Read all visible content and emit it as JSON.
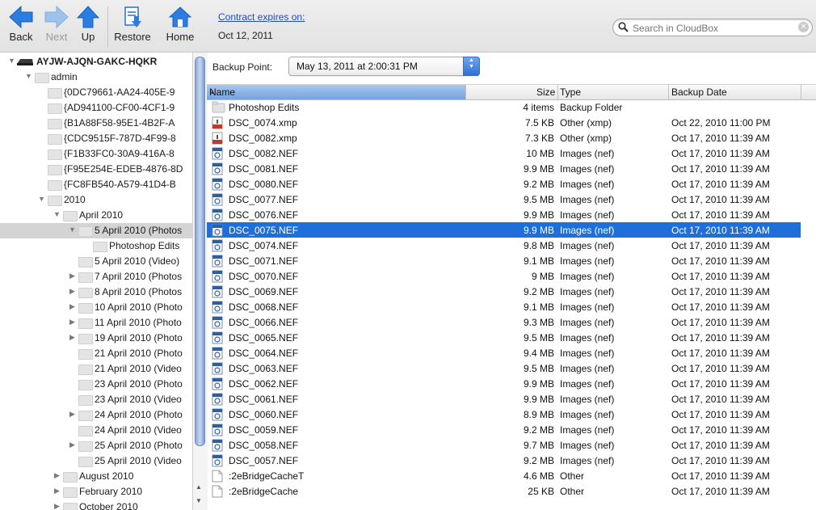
{
  "toolbar": {
    "back": "Back",
    "next": "Next",
    "up": "Up",
    "restore": "Restore",
    "home": "Home"
  },
  "contract": {
    "link": "Contract expires on:",
    "date": "Oct 12, 2011"
  },
  "search": {
    "placeholder": "Search in CloudBox"
  },
  "sidebar": {
    "drive": "AYJW-AJQN-GAKC-HQKR",
    "items": [
      {
        "label": "admin"
      },
      {
        "label": "{0DC79661-AA24-405E-9"
      },
      {
        "label": "{AD941100-CF00-4CF1-9"
      },
      {
        "label": "{B1A88F58-95E1-4B2F-A"
      },
      {
        "label": "{CDC9515F-787D-4F99-8"
      },
      {
        "label": "{F1B33FC0-30A9-416A-8"
      },
      {
        "label": "{F95E254E-EDEB-4876-8D"
      },
      {
        "label": "{FC8FB540-A579-41D4-B"
      },
      {
        "label": "2010"
      },
      {
        "label": "April 2010"
      },
      {
        "label": "5 April 2010 (Photos"
      },
      {
        "label": "Photoshop Edits"
      },
      {
        "label": "5 April 2010 (Video)"
      },
      {
        "label": "7 April 2010 (Photos"
      },
      {
        "label": "8 April 2010 (Photos"
      },
      {
        "label": "10 April 2010 (Photo"
      },
      {
        "label": "11 April 2010 (Photo"
      },
      {
        "label": "19 April 2010 (Photo"
      },
      {
        "label": "21 April 2010 (Photo"
      },
      {
        "label": "21 April 2010 (Video"
      },
      {
        "label": "23 April 2010 (Photo"
      },
      {
        "label": "23 April 2010 (Video"
      },
      {
        "label": "24 April 2010 (Photo"
      },
      {
        "label": "24 April 2010 (Video"
      },
      {
        "label": "25 April 2010 (Photo"
      },
      {
        "label": "25 April 2010 (Video"
      },
      {
        "label": "August 2010"
      },
      {
        "label": "February 2010"
      },
      {
        "label": "October 2010"
      }
    ]
  },
  "backup_point": {
    "label": "Backup Point:",
    "value": "May 13, 2011 at 2:00:31 PM"
  },
  "table": {
    "headers": {
      "name": "Name",
      "size": "Size",
      "type": "Type",
      "date": "Backup Date"
    },
    "rows": [
      {
        "name": "Photoshop Edits",
        "size": "4 items",
        "type": "Backup Folder",
        "date": ""
      },
      {
        "name": "DSC_0074.xmp",
        "size": "7.5 KB",
        "type": "Other (xmp)",
        "date": "Oct 22, 2010 11:00 PM"
      },
      {
        "name": "DSC_0082.xmp",
        "size": "7.3 KB",
        "type": "Other (xmp)",
        "date": "Oct 17, 2010 11:39 AM"
      },
      {
        "name": "DSC_0082.NEF",
        "size": "10 MB",
        "type": "Images (nef)",
        "date": "Oct 17, 2010 11:39 AM"
      },
      {
        "name": "DSC_0081.NEF",
        "size": "9.9 MB",
        "type": "Images (nef)",
        "date": "Oct 17, 2010 11:39 AM"
      },
      {
        "name": "DSC_0080.NEF",
        "size": "9.2 MB",
        "type": "Images (nef)",
        "date": "Oct 17, 2010 11:39 AM"
      },
      {
        "name": "DSC_0077.NEF",
        "size": "9.5 MB",
        "type": "Images (nef)",
        "date": "Oct 17, 2010 11:39 AM"
      },
      {
        "name": "DSC_0076.NEF",
        "size": "9.9 MB",
        "type": "Images (nef)",
        "date": "Oct 17, 2010 11:39 AM"
      },
      {
        "name": "DSC_0075.NEF",
        "size": "9.9 MB",
        "type": "Images (nef)",
        "date": "Oct 17, 2010 11:39 AM"
      },
      {
        "name": "DSC_0074.NEF",
        "size": "9.8 MB",
        "type": "Images (nef)",
        "date": "Oct 17, 2010 11:39 AM"
      },
      {
        "name": "DSC_0071.NEF",
        "size": "9.1 MB",
        "type": "Images (nef)",
        "date": "Oct 17, 2010 11:39 AM"
      },
      {
        "name": "DSC_0070.NEF",
        "size": "9 MB",
        "type": "Images (nef)",
        "date": "Oct 17, 2010 11:39 AM"
      },
      {
        "name": "DSC_0069.NEF",
        "size": "9.2 MB",
        "type": "Images (nef)",
        "date": "Oct 17, 2010 11:39 AM"
      },
      {
        "name": "DSC_0068.NEF",
        "size": "9.1 MB",
        "type": "Images (nef)",
        "date": "Oct 17, 2010 11:39 AM"
      },
      {
        "name": "DSC_0066.NEF",
        "size": "9.3 MB",
        "type": "Images (nef)",
        "date": "Oct 17, 2010 11:39 AM"
      },
      {
        "name": "DSC_0065.NEF",
        "size": "9.5 MB",
        "type": "Images (nef)",
        "date": "Oct 17, 2010 11:39 AM"
      },
      {
        "name": "DSC_0064.NEF",
        "size": "9.4 MB",
        "type": "Images (nef)",
        "date": "Oct 17, 2010 11:39 AM"
      },
      {
        "name": "DSC_0063.NEF",
        "size": "9.5 MB",
        "type": "Images (nef)",
        "date": "Oct 17, 2010 11:39 AM"
      },
      {
        "name": "DSC_0062.NEF",
        "size": "9.9 MB",
        "type": "Images (nef)",
        "date": "Oct 17, 2010 11:39 AM"
      },
      {
        "name": "DSC_0061.NEF",
        "size": "9.9 MB",
        "type": "Images (nef)",
        "date": "Oct 17, 2010 11:39 AM"
      },
      {
        "name": "DSC_0060.NEF",
        "size": "8.9 MB",
        "type": "Images (nef)",
        "date": "Oct 17, 2010 11:39 AM"
      },
      {
        "name": "DSC_0059.NEF",
        "size": "9.2 MB",
        "type": "Images (nef)",
        "date": "Oct 17, 2010 11:39 AM"
      },
      {
        "name": "DSC_0058.NEF",
        "size": "9.7 MB",
        "type": "Images (nef)",
        "date": "Oct 17, 2010 11:39 AM"
      },
      {
        "name": "DSC_0057.NEF",
        "size": "9.2 MB",
        "type": "Images (nef)",
        "date": "Oct 17, 2010 11:39 AM"
      },
      {
        "name": ":2eBridgeCacheT",
        "size": "4.6 MB",
        "type": "Other",
        "date": "Oct 17, 2010 11:39 AM"
      },
      {
        "name": ":2eBridgeCache",
        "size": "25 KB",
        "type": "Other",
        "date": "Oct 17, 2010 11:39 AM"
      }
    ]
  },
  "icons": {
    "back": "back-arrow-icon",
    "next": "next-arrow-icon",
    "up": "up-arrow-icon",
    "restore": "restore-icon",
    "home": "home-icon",
    "folder": "folder-icon",
    "nef": "nef-image-file-icon",
    "xmp": "xmp-file-icon",
    "generic": "generic-file-icon"
  },
  "colors": {
    "selection": "#1e6fd9",
    "toolbar_arrow": "#2a7de1",
    "link": "#2149c9"
  }
}
